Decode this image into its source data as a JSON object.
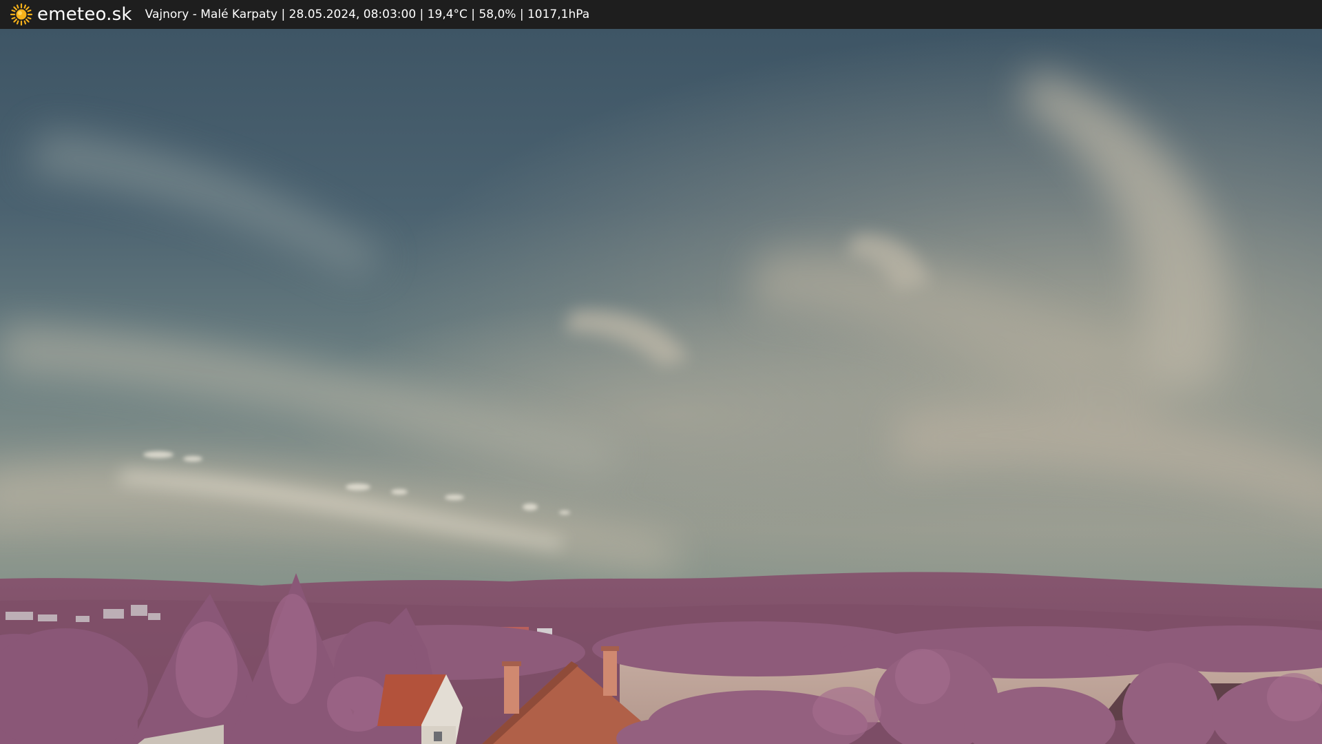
{
  "header": {
    "brand": "emeteo.sk",
    "brand_icon": "sun-icon",
    "caption": "Vajnory - Malé Karpaty | 28.05.2024, 08:03:00 | 19,4°C | 58,0% | 1017,1hPa"
  },
  "colors": {
    "bar_background": "#1e1e1e",
    "sun": "#f7b21a",
    "sky_top": "#3f5566",
    "sky_haze": "#a9a89a",
    "hills": "#8a5a74",
    "foliage": "#9a6786",
    "roof": "#b4553d"
  }
}
